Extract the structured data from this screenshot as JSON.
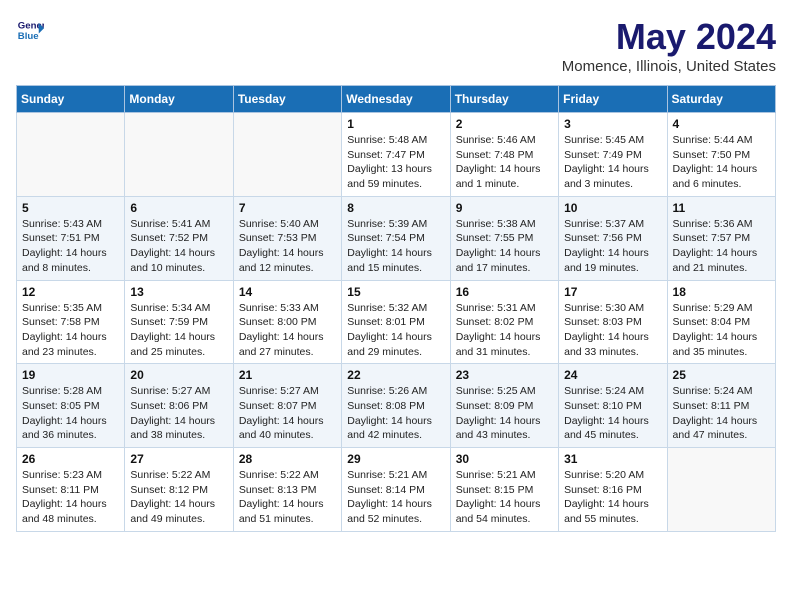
{
  "header": {
    "logo_line1": "General",
    "logo_line2": "Blue",
    "title": "May 2024",
    "subtitle": "Momence, Illinois, United States"
  },
  "days_of_week": [
    "Sunday",
    "Monday",
    "Tuesday",
    "Wednesday",
    "Thursday",
    "Friday",
    "Saturday"
  ],
  "weeks": [
    [
      {
        "day": "",
        "info": ""
      },
      {
        "day": "",
        "info": ""
      },
      {
        "day": "",
        "info": ""
      },
      {
        "day": "1",
        "info": "Sunrise: 5:48 AM\nSunset: 7:47 PM\nDaylight: 13 hours and 59 minutes."
      },
      {
        "day": "2",
        "info": "Sunrise: 5:46 AM\nSunset: 7:48 PM\nDaylight: 14 hours and 1 minute."
      },
      {
        "day": "3",
        "info": "Sunrise: 5:45 AM\nSunset: 7:49 PM\nDaylight: 14 hours and 3 minutes."
      },
      {
        "day": "4",
        "info": "Sunrise: 5:44 AM\nSunset: 7:50 PM\nDaylight: 14 hours and 6 minutes."
      }
    ],
    [
      {
        "day": "5",
        "info": "Sunrise: 5:43 AM\nSunset: 7:51 PM\nDaylight: 14 hours and 8 minutes."
      },
      {
        "day": "6",
        "info": "Sunrise: 5:41 AM\nSunset: 7:52 PM\nDaylight: 14 hours and 10 minutes."
      },
      {
        "day": "7",
        "info": "Sunrise: 5:40 AM\nSunset: 7:53 PM\nDaylight: 14 hours and 12 minutes."
      },
      {
        "day": "8",
        "info": "Sunrise: 5:39 AM\nSunset: 7:54 PM\nDaylight: 14 hours and 15 minutes."
      },
      {
        "day": "9",
        "info": "Sunrise: 5:38 AM\nSunset: 7:55 PM\nDaylight: 14 hours and 17 minutes."
      },
      {
        "day": "10",
        "info": "Sunrise: 5:37 AM\nSunset: 7:56 PM\nDaylight: 14 hours and 19 minutes."
      },
      {
        "day": "11",
        "info": "Sunrise: 5:36 AM\nSunset: 7:57 PM\nDaylight: 14 hours and 21 minutes."
      }
    ],
    [
      {
        "day": "12",
        "info": "Sunrise: 5:35 AM\nSunset: 7:58 PM\nDaylight: 14 hours and 23 minutes."
      },
      {
        "day": "13",
        "info": "Sunrise: 5:34 AM\nSunset: 7:59 PM\nDaylight: 14 hours and 25 minutes."
      },
      {
        "day": "14",
        "info": "Sunrise: 5:33 AM\nSunset: 8:00 PM\nDaylight: 14 hours and 27 minutes."
      },
      {
        "day": "15",
        "info": "Sunrise: 5:32 AM\nSunset: 8:01 PM\nDaylight: 14 hours and 29 minutes."
      },
      {
        "day": "16",
        "info": "Sunrise: 5:31 AM\nSunset: 8:02 PM\nDaylight: 14 hours and 31 minutes."
      },
      {
        "day": "17",
        "info": "Sunrise: 5:30 AM\nSunset: 8:03 PM\nDaylight: 14 hours and 33 minutes."
      },
      {
        "day": "18",
        "info": "Sunrise: 5:29 AM\nSunset: 8:04 PM\nDaylight: 14 hours and 35 minutes."
      }
    ],
    [
      {
        "day": "19",
        "info": "Sunrise: 5:28 AM\nSunset: 8:05 PM\nDaylight: 14 hours and 36 minutes."
      },
      {
        "day": "20",
        "info": "Sunrise: 5:27 AM\nSunset: 8:06 PM\nDaylight: 14 hours and 38 minutes."
      },
      {
        "day": "21",
        "info": "Sunrise: 5:27 AM\nSunset: 8:07 PM\nDaylight: 14 hours and 40 minutes."
      },
      {
        "day": "22",
        "info": "Sunrise: 5:26 AM\nSunset: 8:08 PM\nDaylight: 14 hours and 42 minutes."
      },
      {
        "day": "23",
        "info": "Sunrise: 5:25 AM\nSunset: 8:09 PM\nDaylight: 14 hours and 43 minutes."
      },
      {
        "day": "24",
        "info": "Sunrise: 5:24 AM\nSunset: 8:10 PM\nDaylight: 14 hours and 45 minutes."
      },
      {
        "day": "25",
        "info": "Sunrise: 5:24 AM\nSunset: 8:11 PM\nDaylight: 14 hours and 47 minutes."
      }
    ],
    [
      {
        "day": "26",
        "info": "Sunrise: 5:23 AM\nSunset: 8:11 PM\nDaylight: 14 hours and 48 minutes."
      },
      {
        "day": "27",
        "info": "Sunrise: 5:22 AM\nSunset: 8:12 PM\nDaylight: 14 hours and 49 minutes."
      },
      {
        "day": "28",
        "info": "Sunrise: 5:22 AM\nSunset: 8:13 PM\nDaylight: 14 hours and 51 minutes."
      },
      {
        "day": "29",
        "info": "Sunrise: 5:21 AM\nSunset: 8:14 PM\nDaylight: 14 hours and 52 minutes."
      },
      {
        "day": "30",
        "info": "Sunrise: 5:21 AM\nSunset: 8:15 PM\nDaylight: 14 hours and 54 minutes."
      },
      {
        "day": "31",
        "info": "Sunrise: 5:20 AM\nSunset: 8:16 PM\nDaylight: 14 hours and 55 minutes."
      },
      {
        "day": "",
        "info": ""
      }
    ]
  ]
}
